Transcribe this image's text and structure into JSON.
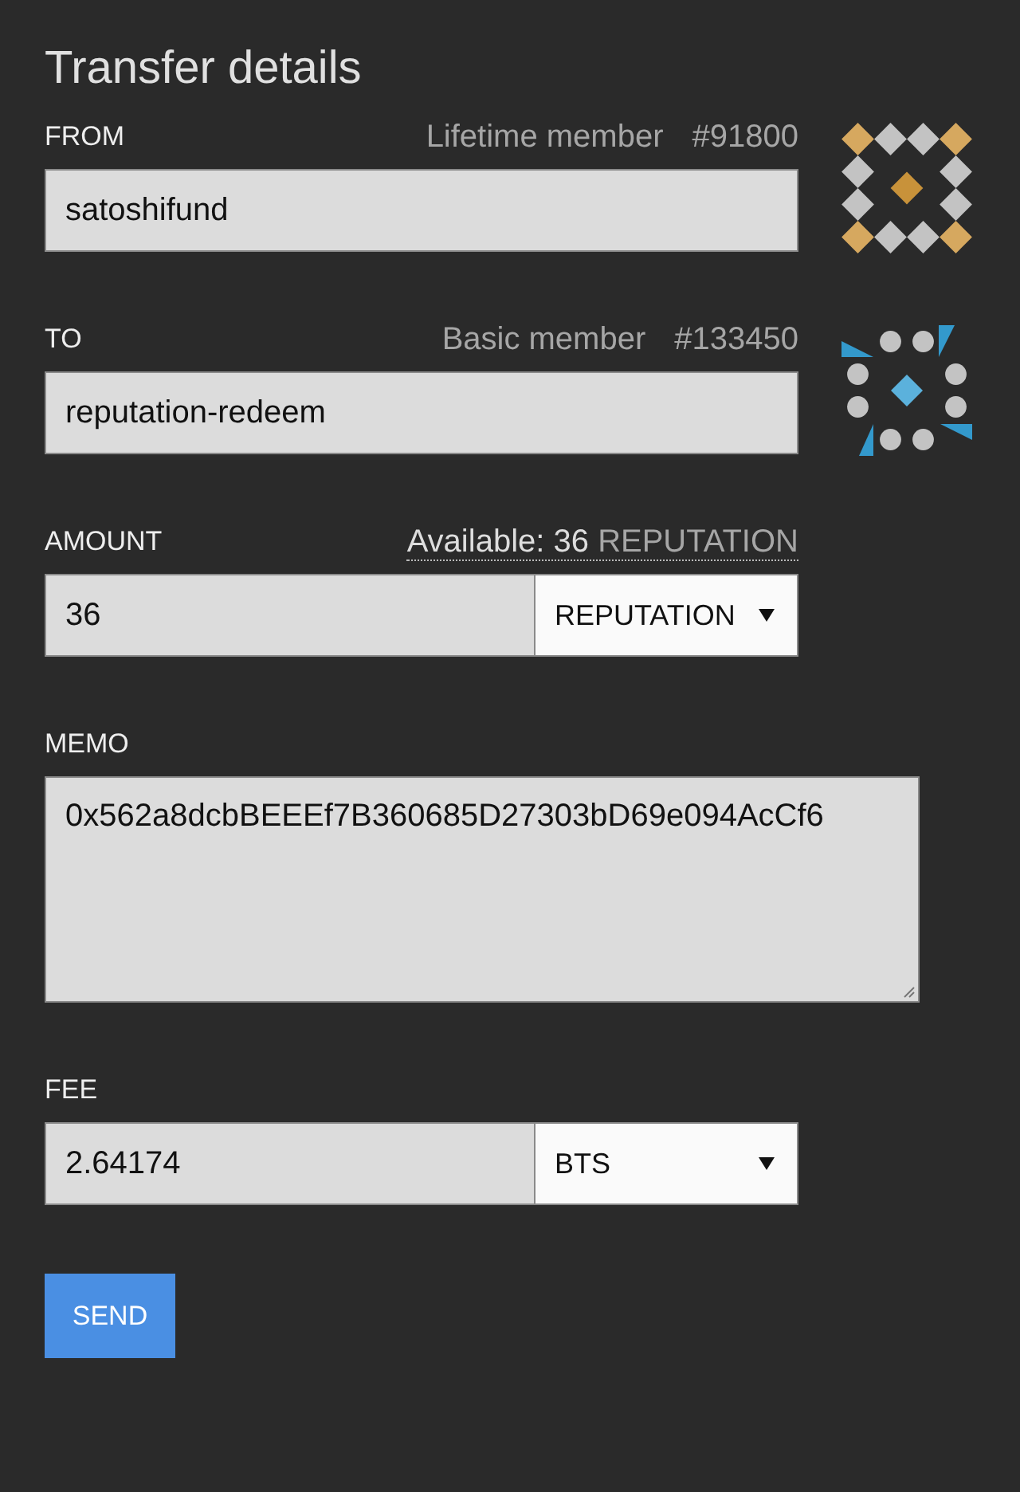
{
  "title": "Transfer details",
  "fields": [
    {
      "kind": "account",
      "label": "FROM",
      "membership": "Lifetime member",
      "member_number": "#91800",
      "value": "satoshifund",
      "avatar": {
        "kind": "diamonds"
      }
    },
    {
      "kind": "account",
      "label": "TO",
      "membership": "Basic member",
      "member_number": "#133450",
      "value": "reputation-redeem",
      "avatar": {
        "kind": "dots"
      }
    },
    {
      "kind": "amount",
      "label": "AMOUNT",
      "available": {
        "label": "Available:",
        "amount": "36",
        "asset": "REPUTATION"
      },
      "value": "36",
      "asset": "REPUTATION"
    },
    {
      "kind": "memo",
      "label": "MEMO",
      "value": "0x562a8dcbBEEEf7B360685D27303bD69e094AcCf6"
    },
    {
      "kind": "fee",
      "label": "FEE",
      "value": "2.64174",
      "asset": "BTS"
    }
  ],
  "send_button": {
    "label": "SEND"
  }
}
